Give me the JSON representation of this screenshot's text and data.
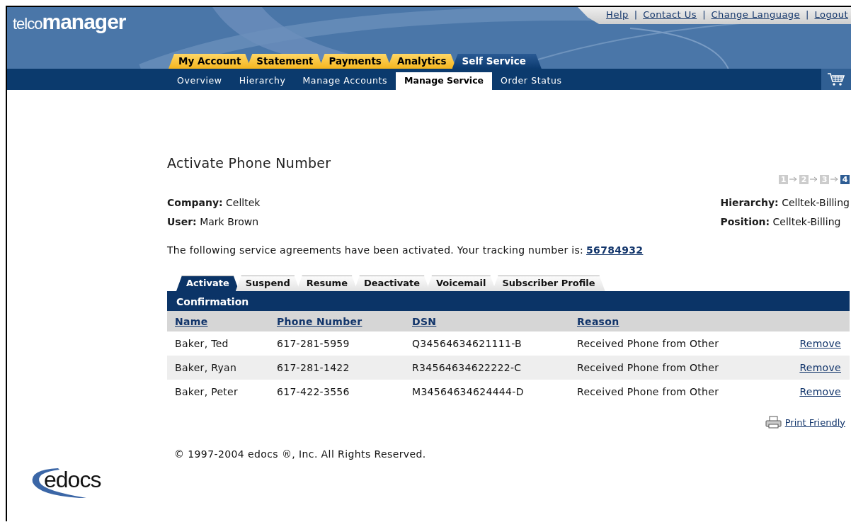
{
  "logo": {
    "prefix": "telco",
    "name": "manager"
  },
  "utility_links": [
    {
      "label": "Help"
    },
    {
      "label": "Contact Us"
    },
    {
      "label": "Change Language"
    },
    {
      "label": "Logout"
    }
  ],
  "utility_separator": "|",
  "main_tabs": [
    {
      "label": "My Account",
      "selected": false
    },
    {
      "label": "Statement",
      "selected": false
    },
    {
      "label": "Payments",
      "selected": false
    },
    {
      "label": "Analytics",
      "selected": false
    },
    {
      "label": "Self Service",
      "selected": true
    }
  ],
  "sub_nav": [
    {
      "label": "Overview",
      "selected": false
    },
    {
      "label": "Hierarchy",
      "selected": false
    },
    {
      "label": "Manage Accounts",
      "selected": false
    },
    {
      "label": "Manage Service",
      "selected": true
    },
    {
      "label": "Order Status",
      "selected": false
    }
  ],
  "page_title": "Activate Phone Number",
  "steps": [
    {
      "label": "1",
      "selected": false
    },
    {
      "label": "2",
      "selected": false
    },
    {
      "label": "3",
      "selected": false
    },
    {
      "label": "4",
      "selected": true
    }
  ],
  "info_left": [
    {
      "label": "Company:",
      "value": "Celltek"
    },
    {
      "label": "User:",
      "value": "Mark Brown"
    }
  ],
  "info_right": [
    {
      "label": "Hierarchy:",
      "value": "Celltek-Billing"
    },
    {
      "label": "Position:",
      "value": "Celltek-Billing"
    }
  ],
  "message": "The following service agreements have been activated. Your tracking number is:",
  "tracking_number": "56784932",
  "service_tabs": [
    {
      "label": "Activate",
      "selected": true
    },
    {
      "label": "Suspend",
      "selected": false
    },
    {
      "label": "Resume",
      "selected": false
    },
    {
      "label": "Deactivate",
      "selected": false
    },
    {
      "label": "Voicemail",
      "selected": false
    },
    {
      "label": "Subscriber Profile",
      "selected": false
    }
  ],
  "table": {
    "title": "Confirmation",
    "columns": [
      "Name",
      "Phone Number",
      "DSN",
      "Reason"
    ],
    "rows": [
      {
        "name": "Baker, Ted",
        "phone": "617-281-5959",
        "dsn": "Q34564634621111-B",
        "reason": "Received Phone from Other",
        "action": "Remove"
      },
      {
        "name": "Baker, Ryan",
        "phone": "617-281-1422",
        "dsn": "R34564634622222-C",
        "reason": "Received Phone from Other",
        "action": "Remove"
      },
      {
        "name": "Baker, Peter",
        "phone": "617-422-3556",
        "dsn": "M34564634624444-D",
        "reason": "Received Phone from Other",
        "action": "Remove"
      }
    ]
  },
  "print_link": "Print Friendly",
  "copyright": "© 1997-2004 edocs ®, Inc. All Rights Reserved.",
  "footer_logo": "edocs"
}
